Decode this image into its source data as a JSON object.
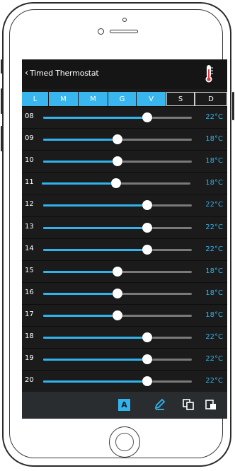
{
  "header": {
    "back_glyph": "‹",
    "title": "Timed Thermostat",
    "icon": "thermometer-icon"
  },
  "days": [
    {
      "label": "L",
      "active": true
    },
    {
      "label": "M",
      "active": true
    },
    {
      "label": "M",
      "active": true
    },
    {
      "label": "G",
      "active": true
    },
    {
      "label": "V",
      "active": true
    },
    {
      "label": "S",
      "active": false
    },
    {
      "label": "D",
      "active": false
    }
  ],
  "schedule": [
    {
      "hour": "08",
      "temp": "22°C",
      "level": 0.7
    },
    {
      "hour": "09",
      "temp": "18°C",
      "level": 0.5
    },
    {
      "hour": "10",
      "temp": "18°C",
      "level": 0.5
    },
    {
      "hour": "11",
      "temp": "18°C",
      "level": 0.5
    },
    {
      "hour": "12",
      "temp": "22°C",
      "level": 0.7
    },
    {
      "hour": "13",
      "temp": "22°C",
      "level": 0.7
    },
    {
      "hour": "14",
      "temp": "22°C",
      "level": 0.7
    },
    {
      "hour": "15",
      "temp": "18°C",
      "level": 0.5
    },
    {
      "hour": "16",
      "temp": "18°C",
      "level": 0.5
    },
    {
      "hour": "17",
      "temp": "18°C",
      "level": 0.5
    },
    {
      "hour": "18",
      "temp": "22°C",
      "level": 0.7
    },
    {
      "hour": "19",
      "temp": "22°C",
      "level": 0.7
    },
    {
      "hour": "20",
      "temp": "22°C",
      "level": 0.7
    }
  ],
  "toolbar": {
    "auto_label": "A",
    "icons": [
      "edit-icon",
      "copy-icon",
      "paste-icon"
    ]
  },
  "colors": {
    "accent": "#2fb4ee",
    "background": "#1b1b1b",
    "toolbar": "#2a2d30"
  }
}
